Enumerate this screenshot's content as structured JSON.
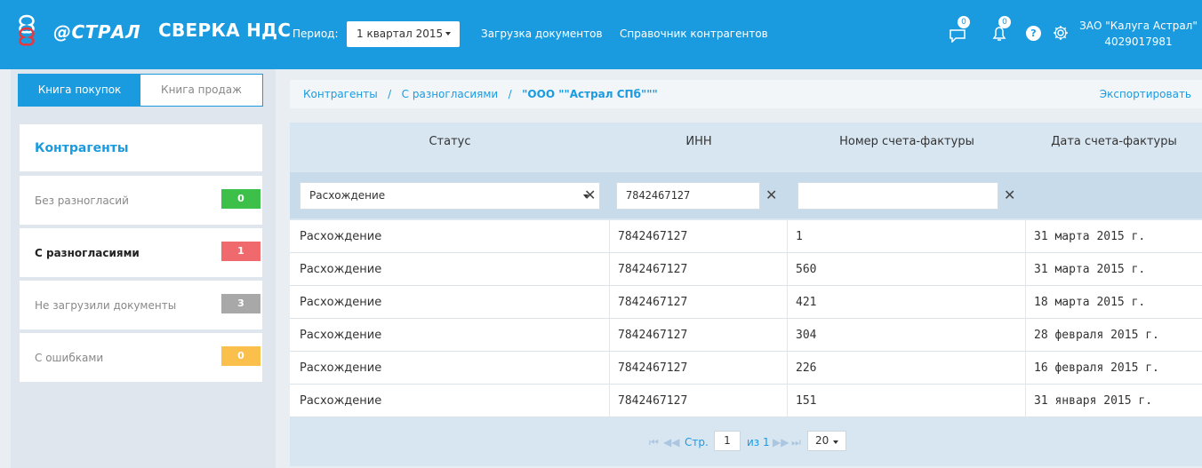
{
  "header": {
    "logo_text": "@СТРАЛ",
    "app_title": "СВЕРКА НДС",
    "period_label": "Период:",
    "period_value": "1 квартал 2015",
    "nav": [
      "Загрузка документов",
      "Справочник контрагентов"
    ],
    "messages_count": "0",
    "notifications_count": "0",
    "help_label": "?",
    "org_name": "ЗАО \"Калуга Астрал\"",
    "org_inn": "4029017981",
    "colors": {
      "brand": "#1a9be0"
    }
  },
  "sidebar": {
    "tabs": [
      {
        "label": "Книга покупок",
        "active": true
      },
      {
        "label": "Книга продаж",
        "active": false
      }
    ],
    "heading": "Контрагенты",
    "items": [
      {
        "label": "Без разногласий",
        "count": "0",
        "color": "#3cc04a"
      },
      {
        "label": "С разногласиями",
        "count": "1",
        "color": "#f06a6d"
      },
      {
        "label": "Не загрузили документы",
        "count": "3",
        "color": "#a8a8a8"
      },
      {
        "label": "С ошибками",
        "count": "0",
        "color": "#fbbf4b"
      }
    ]
  },
  "breadcrumb": {
    "parts": [
      "Контрагенты",
      "С разногласиями"
    ],
    "current": "\"ООО \"\"Астрал СПб\"\"\"",
    "separator": "/",
    "export_label": "Экспортировать"
  },
  "table": {
    "columns": [
      "Статус",
      "ИНН",
      "Номер счета-фактуры",
      "Дата счета-фактуры"
    ],
    "filters": {
      "status": "Расхождение",
      "inn": "7842467127",
      "number": ""
    },
    "rows": [
      [
        "Расхождение",
        "7842467127",
        "1",
        "31 марта 2015 г."
      ],
      [
        "Расхождение",
        "7842467127",
        "560",
        "31 марта 2015 г."
      ],
      [
        "Расхождение",
        "7842467127",
        "421",
        "18 марта 2015 г."
      ],
      [
        "Расхождение",
        "7842467127",
        "304",
        "28 февраля 2015 г."
      ],
      [
        "Расхождение",
        "7842467127",
        "226",
        "16 февраля 2015 г."
      ],
      [
        "Расхождение",
        "7842467127",
        "151",
        "31 января 2015 г."
      ]
    ]
  },
  "pager": {
    "page_label": "Стр.",
    "page": "1",
    "of_label": "из 1",
    "page_size": "20"
  }
}
